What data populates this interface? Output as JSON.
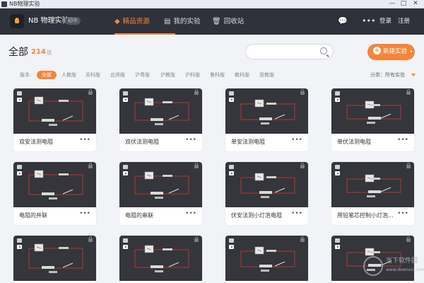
{
  "window": {
    "title": "NB物理实验",
    "controls": [
      "—",
      "□",
      "✕"
    ]
  },
  "topbar": {
    "brand": "NB 物理实验",
    "tag": "初中",
    "nav": [
      {
        "label": "精品资源",
        "icon": "gem-icon",
        "active": true
      },
      {
        "label": "我的实验",
        "icon": "notebook-icon",
        "active": false
      },
      {
        "label": "回收站",
        "icon": "trash-icon",
        "active": false
      }
    ],
    "login": "登录",
    "register": "注册"
  },
  "header": {
    "title": "全部",
    "count": "214",
    "unit": "项",
    "search_placeholder": "",
    "new_button": "新建实验"
  },
  "filters": {
    "label": "版本:",
    "items": [
      "全部",
      "人教版",
      "苏科版",
      "北师版",
      "沪粤版",
      "沪教版",
      "沪科版",
      "鲁科版",
      "教科版",
      "浙教版"
    ],
    "active_index": 0,
    "sort_label": "分类：所有实验"
  },
  "cards": [
    {
      "name": "双安法测电阻"
    },
    {
      "name": "双伏法测电阻"
    },
    {
      "name": "单安法测电阻"
    },
    {
      "name": "单伏法测电阻"
    },
    {
      "name": "电阻的并联"
    },
    {
      "name": "电阻的串联"
    },
    {
      "name": "伏安法测小灯泡电阻"
    },
    {
      "name": "用铅笔芯控制小灯泡..."
    },
    {
      "name": ""
    },
    {
      "name": ""
    },
    {
      "name": ""
    },
    {
      "name": ""
    }
  ],
  "card_more": "•••",
  "watermark": {
    "text": "当下软件园",
    "sub": "www.downxia.com"
  },
  "colors": {
    "accent": "#f4853a",
    "topbar": "#2f323a",
    "thumb_bg": "#34363c",
    "wire": "#d23a2a"
  }
}
